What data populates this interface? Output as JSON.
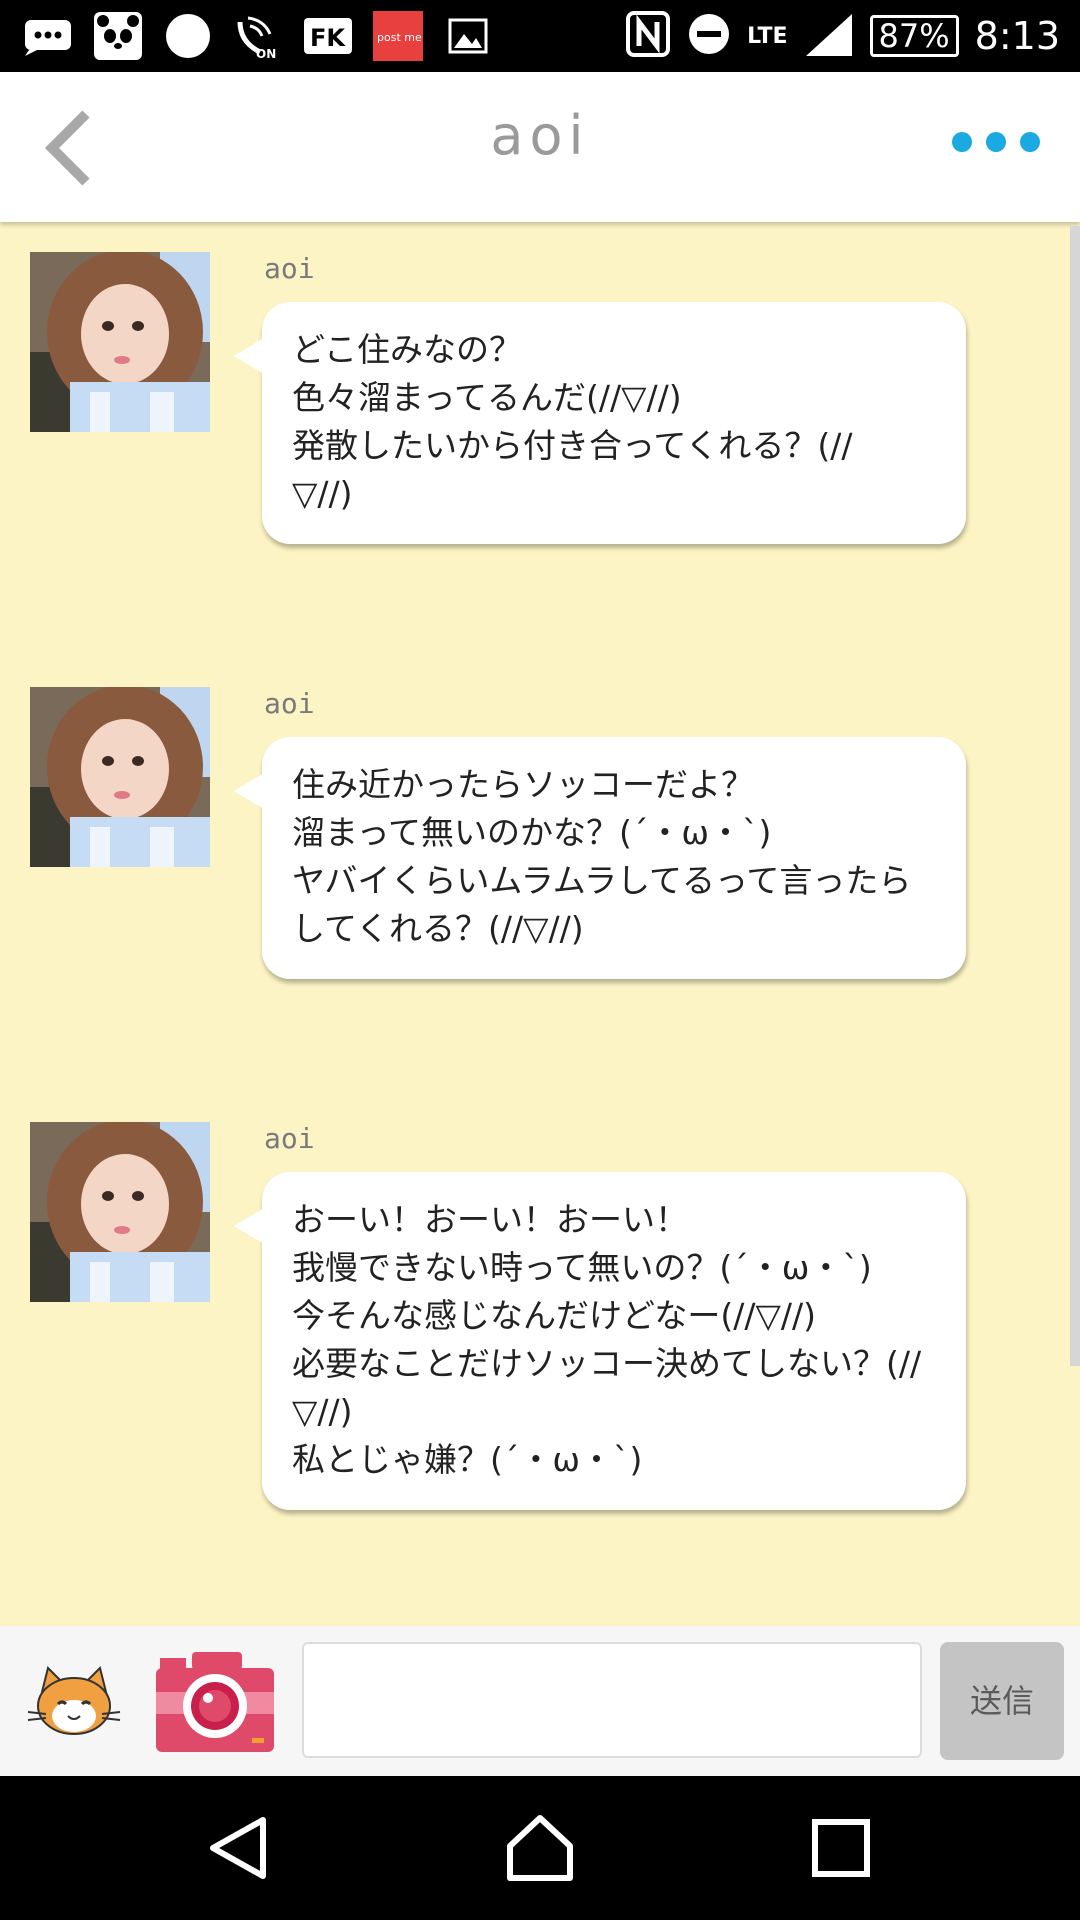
{
  "statusbar": {
    "battery": "87%",
    "time": "8:13",
    "network": "LTE",
    "notification_icons": [
      "message-icon",
      "panda-icon",
      "circle-icon",
      "wifi-calling-icon",
      "fk-app-icon",
      "postme-app-icon",
      "image-icon"
    ],
    "postme_label": "post me",
    "fk_label": "FK"
  },
  "header": {
    "title": "aoi",
    "accent_color": "#1aa9e0"
  },
  "messages": [
    {
      "sender": "aoi",
      "lines": [
        "どこ住みなの？",
        "色々溜まってるんだ(//▽//)",
        "発散したいから付き合ってくれる？(//",
        "▽//)"
      ]
    },
    {
      "sender": "aoi",
      "lines": [
        "住み近かったらソッコーだよ？",
        "溜まって無いのかな？(´・ω・`)",
        "ヤバイくらいムラムラしてるって言ったら",
        "してくれる？(//▽//)"
      ]
    },
    {
      "sender": "aoi",
      "lines": [
        "おーい！おーい！おーい！",
        "我慢できない時って無いの？(´・ω・`)",
        "今そんな感じなんだけどなー(//▽//)",
        "必要なことだけソッコー決めてしない？(//",
        "▽//)",
        "私とじゃ嫌？(´・ω・`)"
      ]
    }
  ],
  "input": {
    "value": "",
    "placeholder": "",
    "send_label": "送信"
  },
  "colors": {
    "chat_background": "#fcf4c4",
    "camera": "#e04a6a",
    "send_button": "#c4c4c4"
  }
}
